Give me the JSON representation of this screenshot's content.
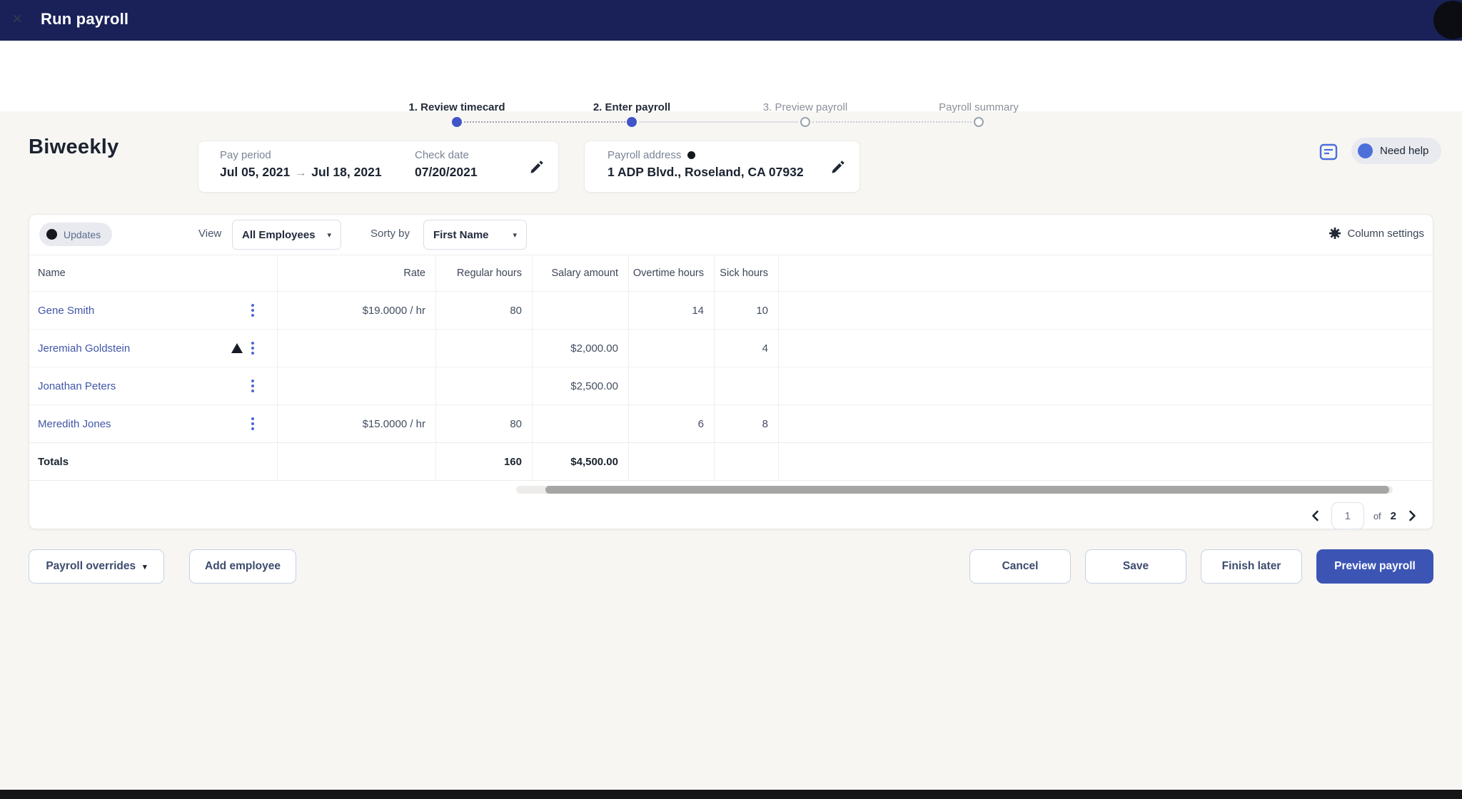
{
  "top_bar": {
    "title": "Run payroll"
  },
  "icons": {
    "close": "×",
    "caret": "▾",
    "arrow_right": "→"
  },
  "stepper": {
    "steps": [
      {
        "label": "1. Review timecard",
        "state": "complete"
      },
      {
        "label": "2. Enter payroll",
        "state": "current"
      },
      {
        "label": "3. Preview payroll",
        "state": "upcoming"
      },
      {
        "label": "Payroll summary",
        "state": "upcoming"
      }
    ]
  },
  "schedule": {
    "title": "Biweekly"
  },
  "pay_period_card": {
    "label": "Pay period",
    "start_date": "Jul 05, 2021",
    "end_date": "Jul 18, 2021",
    "check_date_label": "Check date",
    "check_date": "07/20/2021"
  },
  "address_card": {
    "label": "Payroll address",
    "value": "1 ADP Blvd., Roseland, CA 07932"
  },
  "help": {
    "label": "Need help"
  },
  "table": {
    "controls": {
      "updates_label": "Updates",
      "view_label": "View",
      "view_value": "All Employees",
      "sort_label": "Sorty by",
      "sort_value": "First Name",
      "column_settings_label": "Column settings"
    },
    "columns": [
      "Name",
      "Rate",
      "Regular hours",
      "Salary amount",
      "Overtime hours",
      "Sick hours"
    ],
    "rows": [
      {
        "name": "Gene Smith",
        "warning": false,
        "rate": "$19.0000 / hr",
        "regular_hours": "80",
        "salary_amount": "",
        "overtime_hours": "14",
        "sick_hours": "10"
      },
      {
        "name": "Jeremiah Goldstein",
        "warning": true,
        "rate": "",
        "regular_hours": "",
        "salary_amount": "$2,000.00",
        "overtime_hours": "",
        "sick_hours": "4"
      },
      {
        "name": "Jonathan Peters",
        "warning": false,
        "rate": "",
        "regular_hours": "",
        "salary_amount": "$2,500.00",
        "overtime_hours": "",
        "sick_hours": ""
      },
      {
        "name": "Meredith Jones",
        "warning": false,
        "rate": "$15.0000 / hr",
        "regular_hours": "80",
        "salary_amount": "",
        "overtime_hours": "6",
        "sick_hours": "8"
      }
    ],
    "totals": {
      "label": "Totals",
      "regular_hours": "160",
      "salary_amount": "$4,500.00"
    }
  },
  "pagination": {
    "page": "1",
    "of_label": "of",
    "total_pages": "2"
  },
  "actions": {
    "payroll_overrides": "Payroll overrides",
    "add_employee": "Add employee",
    "cancel": "Cancel",
    "save": "Save",
    "finish_later": "Finish later",
    "preview_payroll": "Preview payroll"
  },
  "colors": {
    "topbar": "#1a2158",
    "accent_indigo": "#3c55b5",
    "stepper_dot": "#4055c8",
    "link_blue": "#4156a8",
    "help_dot": "#4d6fd9",
    "page_background": "#f7f6f3"
  }
}
